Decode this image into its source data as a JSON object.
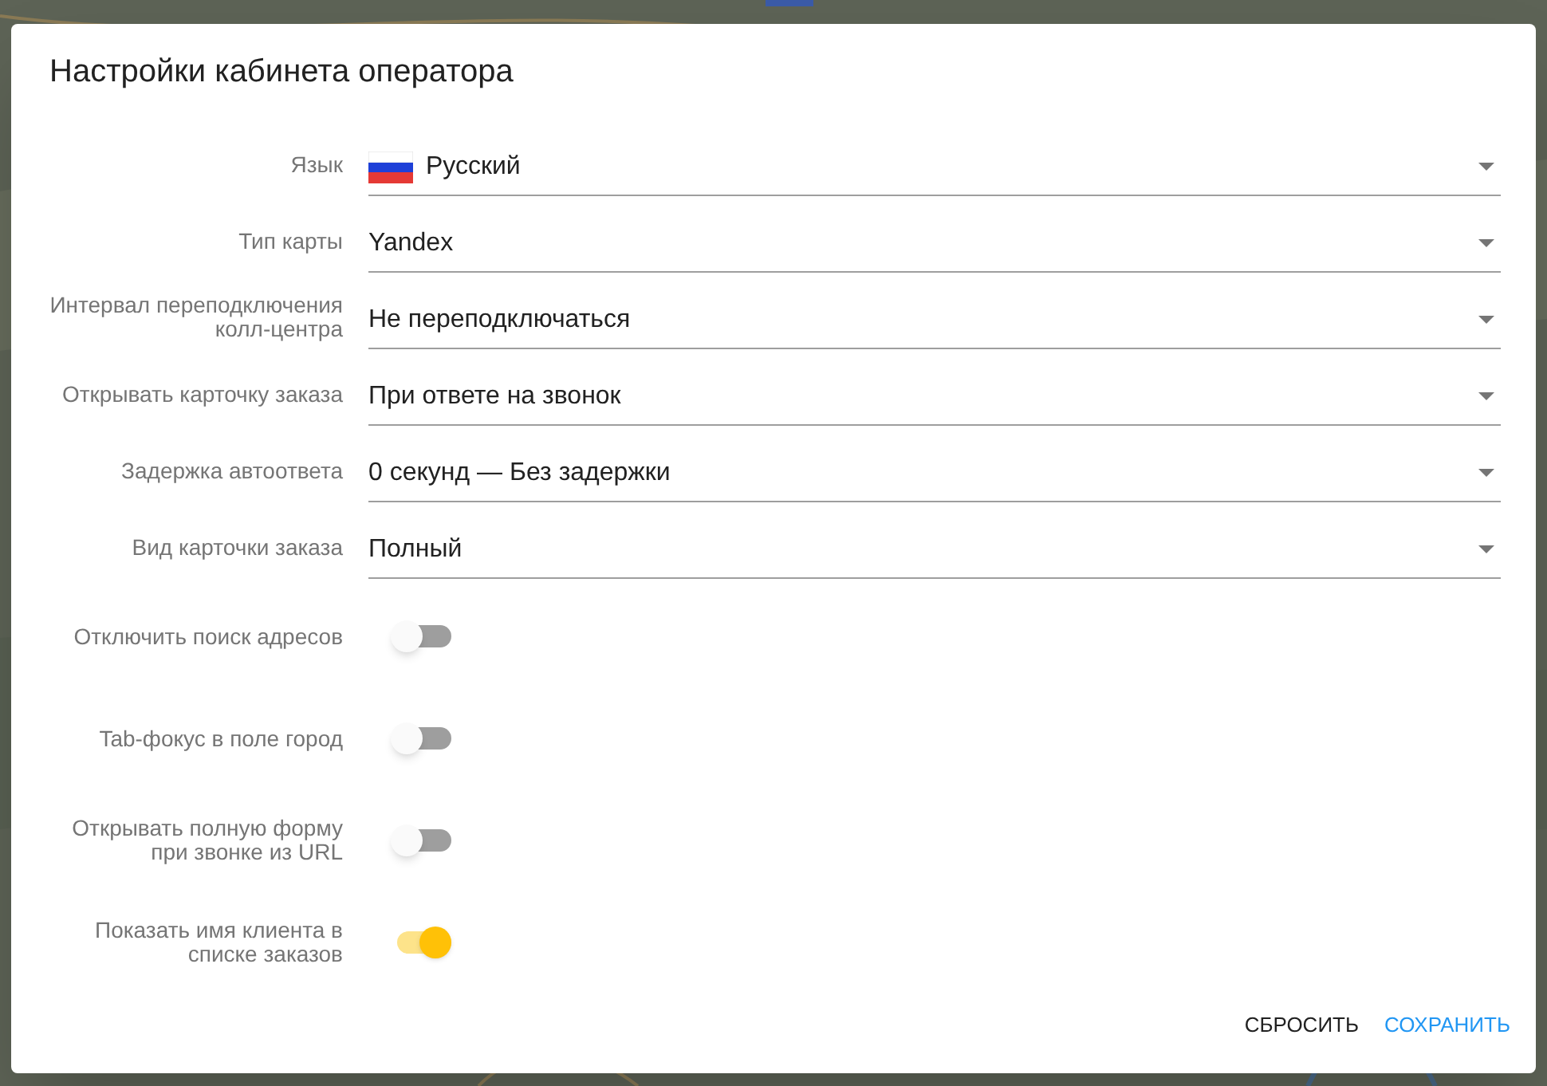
{
  "dialog": {
    "title": "Настройки кабинета оператора",
    "settings": [
      {
        "kind": "select",
        "label": "Язык",
        "value": "Русский",
        "flag": true
      },
      {
        "kind": "select",
        "label": "Тип карты",
        "value": "Yandex"
      },
      {
        "kind": "select",
        "label": "Интервал переподключения колл-центра",
        "value": "Не переподключаться"
      },
      {
        "kind": "select",
        "label": "Открывать карточку заказа",
        "value": "При ответе на звонок"
      },
      {
        "kind": "select",
        "label": "Задержка автоответа",
        "value": "0 секунд — Без задержки"
      },
      {
        "kind": "select",
        "label": "Вид карточки заказа",
        "value": "Полный"
      },
      {
        "kind": "toggle",
        "label": "Отключить поиск адресов",
        "on": false
      },
      {
        "kind": "toggle",
        "label": "Tab-фокус в поле город",
        "on": false
      },
      {
        "kind": "toggle",
        "label": "Открывать полную форму при звонке из URL",
        "on": false
      },
      {
        "kind": "toggle",
        "label": "Показать имя клиента в списке заказов",
        "on": true
      }
    ],
    "buttons": [
      {
        "label": "СБРОСИТЬ",
        "kind": "secondary"
      },
      {
        "label": "СОХРАНИТЬ",
        "kind": "primary"
      }
    ]
  }
}
